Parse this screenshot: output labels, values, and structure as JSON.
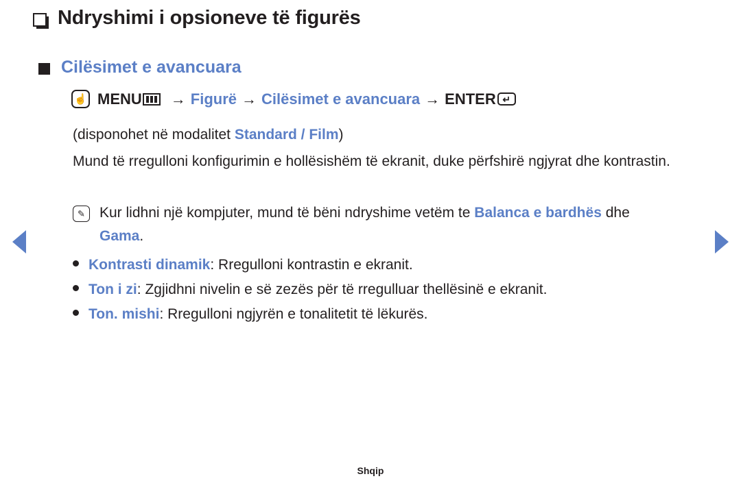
{
  "page": {
    "title": "Ndryshimi i opsioneve të figurës",
    "title_bullet_icon": "hollow-square-icon",
    "section_heading": "Cilësimet e avancuara",
    "section_bullet_icon": "filled-square-icon"
  },
  "menu_path": {
    "remote_icon": "touch-hand-button-icon",
    "menu_label": "MENU",
    "menu_icon": "menu-grid-icon",
    "arrow": "→",
    "step1": "Figurë",
    "step2": "Cilësimet e avancuara",
    "enter_label": "ENTER",
    "enter_icon": "enter-return-icon",
    "enter_glyph": "↵"
  },
  "availability": {
    "prefix": "(disponohet në modalitet ",
    "modes": "Standard / Film",
    "suffix": ")"
  },
  "description": {
    "text": "Mund të rregulloni konfigurimin e hollësishëm të ekranit, duke përfshirë ngjyrat dhe kontrastin."
  },
  "note": {
    "icon": "note-pencil-icon",
    "part1": "Kur lidhni një kompjuter, mund të bëni ndryshime vetëm te ",
    "highlight1": "Balanca e bardhës",
    "part2": " dhe ",
    "highlight2": "Gama",
    "part3": "."
  },
  "bullets": [
    {
      "label": "Kontrasti dinamik",
      "separator": ": ",
      "text": "Rregulloni kontrastin e ekranit."
    },
    {
      "label": "Ton i zi",
      "separator": ": ",
      "text": "Zgjidhni nivelin e së zezës për të rregulluar thellësinë e ekranit."
    },
    {
      "label": "Ton. mishi",
      "separator": ": ",
      "text": "Rregulloni ngjyrën e tonalitetit të lëkurës."
    }
  ],
  "navigation": {
    "prev_icon": "prev-page-arrow-icon",
    "next_icon": "next-page-arrow-icon"
  },
  "footer": {
    "language": "Shqip"
  },
  "colors": {
    "accent_blue": "#5b7fc6",
    "text_dark": "#231f20",
    "background": "#ffffff"
  }
}
